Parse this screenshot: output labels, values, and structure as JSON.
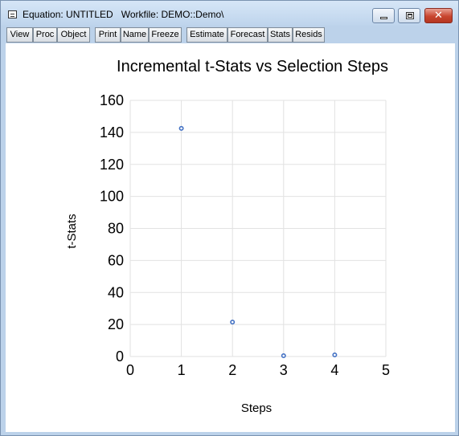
{
  "window": {
    "title": "Equation: UNTITLED   Workfile: DEMO::Demo\\",
    "controls": {
      "minimize_icon": "minimize-icon",
      "maximize_icon": "maximize-icon",
      "close_icon": "close-icon",
      "close_glyph": "✕"
    }
  },
  "toolbar": {
    "buttons": [
      "View",
      "Proc",
      "Object",
      "Print",
      "Name",
      "Freeze",
      "Estimate",
      "Forecast",
      "Stats",
      "Resids"
    ]
  },
  "chart_data": {
    "type": "scatter",
    "title": "Incremental t-Stats vs Selection Steps",
    "xlabel": "Steps",
    "ylabel": "t-Stats",
    "xlim": [
      0,
      5
    ],
    "ylim": [
      0,
      160
    ],
    "xticks": [
      "0",
      "1",
      "2",
      "3",
      "4",
      "5"
    ],
    "yticks": [
      "0",
      "20",
      "40",
      "60",
      "80",
      "100",
      "120",
      "140",
      "160"
    ],
    "grid": true,
    "points": [
      {
        "x": 1,
        "y": 142.5
      },
      {
        "x": 2,
        "y": 21.5
      },
      {
        "x": 3,
        "y": 0.5
      },
      {
        "x": 4,
        "y": 1
      }
    ],
    "colors": {
      "marker": "#4472c4",
      "grid": "#e2e2e2",
      "axis_text": "#000000"
    }
  }
}
